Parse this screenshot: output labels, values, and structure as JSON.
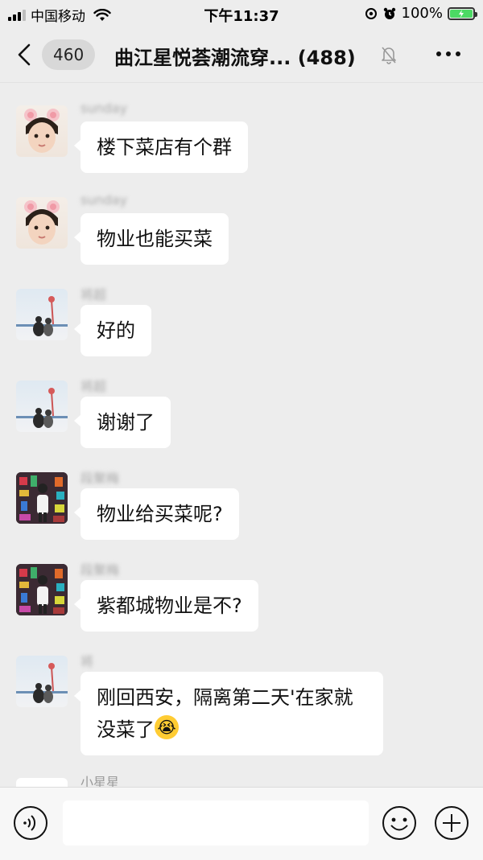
{
  "status_bar": {
    "carrier": "中国移动",
    "time": "下午11:37",
    "battery": "100%"
  },
  "nav": {
    "unread_count": "460",
    "title": "曲江星悦荟潮流穿... (488)"
  },
  "messages": [
    {
      "sender": "sunday",
      "text": "楼下菜店有个群",
      "avatar": "girl-bunny-ears"
    },
    {
      "sender": "sunday",
      "text": "物业也能买菜",
      "avatar": "girl-bunny-ears"
    },
    {
      "sender": "将超",
      "text": "好的",
      "avatar": "seaside-couple"
    },
    {
      "sender": "将超",
      "text": "谢谢了",
      "avatar": "seaside-couple"
    },
    {
      "sender": "段聚梅",
      "text": "物业给买菜呢?",
      "avatar": "colorful-pattern"
    },
    {
      "sender": "段聚梅",
      "text": "紫都城物业是不?",
      "avatar": "colorful-pattern"
    },
    {
      "sender": "将",
      "text": "刚回西安，隔离第二天'在家就没菜了",
      "emoji": "😭",
      "avatar": "seaside-couple"
    },
    {
      "sender": "小星星",
      "text": "",
      "avatar": "white"
    }
  ],
  "input": {
    "placeholder": ""
  },
  "colors": {
    "background": "#ededed",
    "bubble": "#ffffff",
    "battery": "#4cd964"
  }
}
